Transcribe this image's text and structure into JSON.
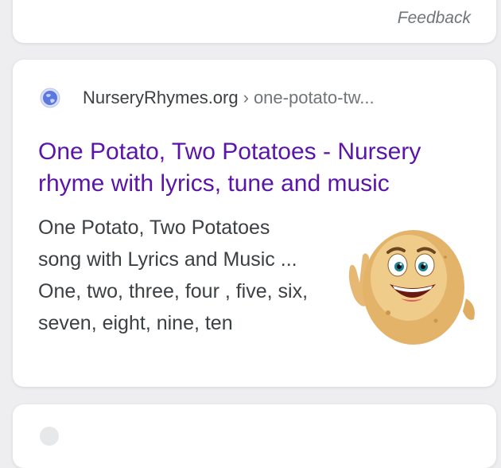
{
  "feedback": {
    "label": "Feedback"
  },
  "result": {
    "site_name": "NurseryRhymes.org",
    "site_separator": "›",
    "site_path": "one-potato-tw...",
    "title": "One Potato, Two Potatoes - Nursery rhyme with lyrics, tune and music",
    "snippet": "One Potato, Two Potatoes song with Lyrics and Music ... One, two, three, four , five, six, seven, eight, nine, ten",
    "globe_icon": "globe-icon",
    "thumbnail": "potato-cartoon-character"
  },
  "colors": {
    "title_link": "#5a14a8",
    "text": "#3c4043",
    "muted": "#70757a"
  }
}
